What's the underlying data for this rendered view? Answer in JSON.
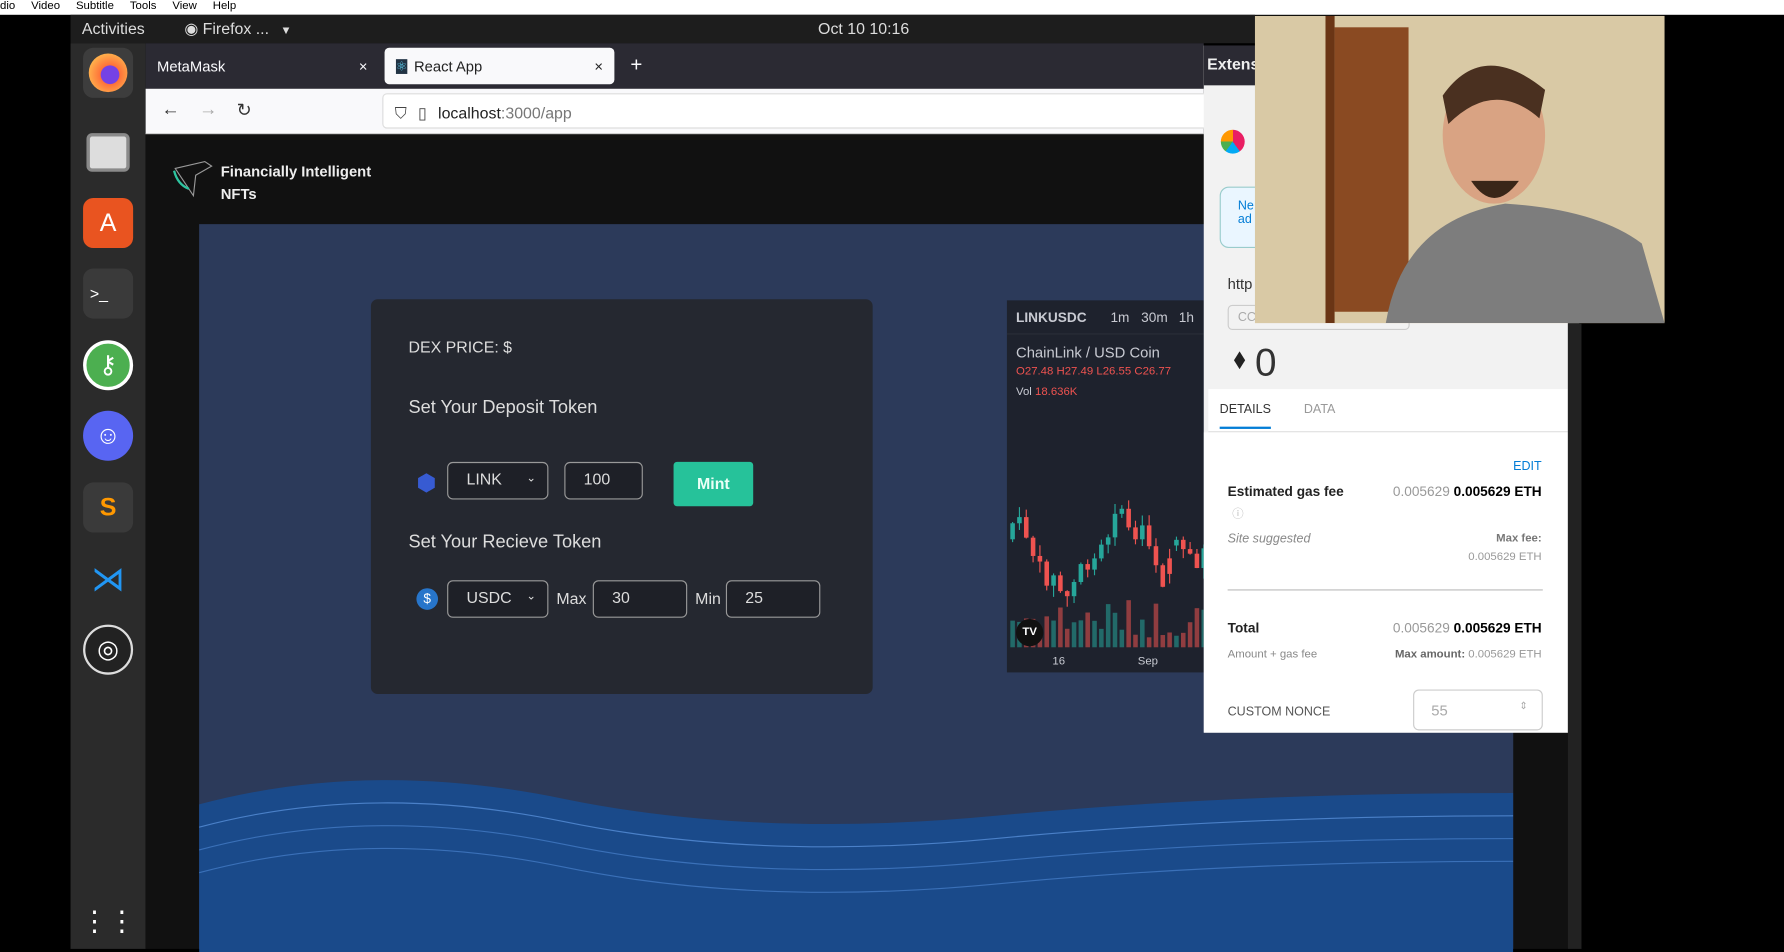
{
  "player_menu": [
    "dio",
    "Video",
    "Subtitle",
    "Tools",
    "View",
    "Help"
  ],
  "topbar": {
    "activities": "Activities",
    "app": "Firefox ...",
    "clock": "Oct 10  10:16"
  },
  "browser": {
    "tabs": [
      {
        "label": "MetaMask",
        "close": "×"
      },
      {
        "label": "React App",
        "close": "×"
      }
    ],
    "new_tab": "+",
    "url_host": "localhost",
    "url_path": ":3000/app"
  },
  "app": {
    "logo_line1": "Financially Intelligent",
    "logo_line2": "NFTs",
    "dex_price": "DEX PRICE: $",
    "deposit_heading": "Set Your Deposit Token",
    "deposit_token": "LINK",
    "deposit_amount": "100",
    "mint": "Mint",
    "receive_heading": "Set Your Recieve Token",
    "receive_token": "USDC",
    "max_label": "Max",
    "max_value": "30",
    "min_label": "Min",
    "min_value": "25"
  },
  "chart": {
    "symbol": "LINKUSDC",
    "intervals": [
      "1m",
      "30m",
      "1h"
    ],
    "pair": "ChainLink / USD Coin",
    "o": "O27.48",
    "h": "H27.49",
    "l": "L26.55",
    "c": "C26.77",
    "vol_label": "Vol",
    "vol": "18.636K",
    "x_ticks": [
      "16",
      "Sep"
    ],
    "logo": "TV",
    "up_color": "#26a69a",
    "down_color": "#ef5350"
  },
  "metamask": {
    "header": "Extens",
    "notice": "Ne ad",
    "origin": "http",
    "input": "CC",
    "balance": "0",
    "tabs": [
      "DETAILS",
      "DATA"
    ],
    "edit": "EDIT",
    "gas_label": "Estimated gas fee",
    "gas_fiat": "0.005629",
    "gas_eth": "0.005629 ETH",
    "site_suggested": "Site suggested",
    "max_fee_label": "Max fee:",
    "max_fee": "0.005629 ETH",
    "total_label": "Total",
    "total_fiat": "0.005629",
    "total_eth": "0.005629 ETH",
    "amount_gas": "Amount + gas fee",
    "max_amount_label": "Max amount:",
    "max_amount": "0.005629 ETH",
    "nonce_label": "CUSTOM NONCE",
    "nonce": "55",
    "accent": "#037dd6"
  }
}
